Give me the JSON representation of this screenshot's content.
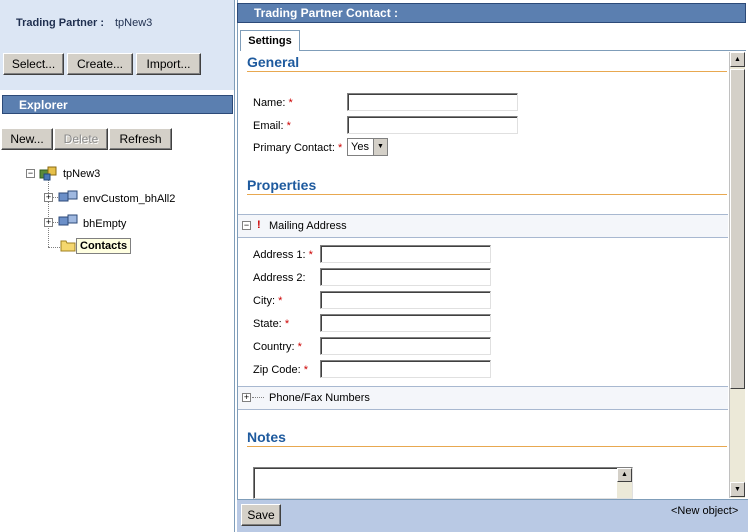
{
  "left": {
    "trading_partner_label": "Trading Partner :",
    "trading_partner_value": "tpNew3",
    "buttons": {
      "select": "Select...",
      "create": "Create...",
      "import": "Import..."
    },
    "explorer_title": "Explorer",
    "explorer_buttons": {
      "new": "New...",
      "delete": "Delete",
      "refresh": "Refresh"
    },
    "tree": {
      "root": "tpNew3",
      "items": [
        "envCustom_bhAll2",
        "bhEmpty",
        "Contacts"
      ]
    }
  },
  "right": {
    "header_title": "Trading Partner Contact :",
    "tab_settings": "Settings",
    "general": {
      "title": "General",
      "name_label": "Name:",
      "email_label": "Email:",
      "primary_contact_label": "Primary Contact:",
      "primary_contact_value": "Yes",
      "required_mark": "*"
    },
    "properties": {
      "title": "Properties",
      "mailing_address": "Mailing Address",
      "address1_label": "Address 1:",
      "address2_label": "Address 2:",
      "city_label": "City:",
      "state_label": "State:",
      "country_label": "Country:",
      "zip_label": "Zip Code:",
      "phone_fax": "Phone/Fax Numbers",
      "warning_mark": "!"
    },
    "notes": {
      "title": "Notes"
    },
    "save_button": "Save",
    "status_text": "<New object>"
  },
  "colors": {
    "header_bg": "#5b7fb0",
    "section_title": "#1e5a9e",
    "section_rule": "#e8a850",
    "required": "#cc0000"
  }
}
